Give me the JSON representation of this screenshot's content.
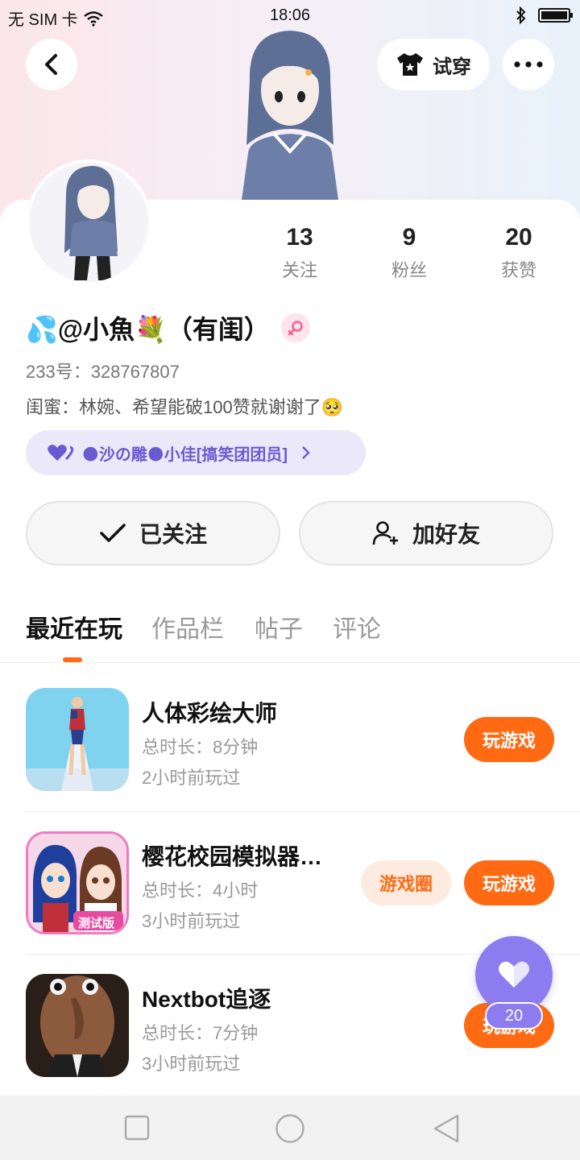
{
  "status_bar": {
    "carrier": "无 SIM 卡",
    "time": "18:06"
  },
  "top": {
    "tryon_label": "试穿"
  },
  "profile": {
    "name": "💦@小魚💐（有闺）",
    "uid": "233号：328767807",
    "bio": "闺蜜：林婉、希望能破100赞就谢谢了🥺",
    "group": "🌑沙の雕🌑小佳[搞笑团团员]",
    "stats": [
      {
        "value": "13",
        "label": "关注"
      },
      {
        "value": "9",
        "label": "粉丝"
      },
      {
        "value": "20",
        "label": "获赞"
      }
    ]
  },
  "actions": {
    "followed_label": "已关注",
    "add_friend_label": "加好友"
  },
  "tabs": [
    "最近在玩",
    "作品栏",
    "帖子",
    "评论"
  ],
  "games": [
    {
      "title": "人体彩绘大师",
      "duration": "总时长：8分钟",
      "last_played": "2小时前玩过",
      "play_label": "玩游戏"
    },
    {
      "title": "樱花校园模拟器测试版",
      "duration": "总时长：4小时",
      "last_played": "3小时前玩过",
      "play_label": "玩游戏",
      "circle_label": "游戏圈",
      "icon_badge": "测试版"
    },
    {
      "title": "Nextbot追逐",
      "duration": "总时长：7分钟",
      "last_played": "3小时前玩过",
      "play_label": "玩游戏"
    }
  ],
  "like": {
    "count": "20"
  },
  "colors": {
    "accent": "#ff6a13",
    "purple": "#8d7bf0"
  }
}
